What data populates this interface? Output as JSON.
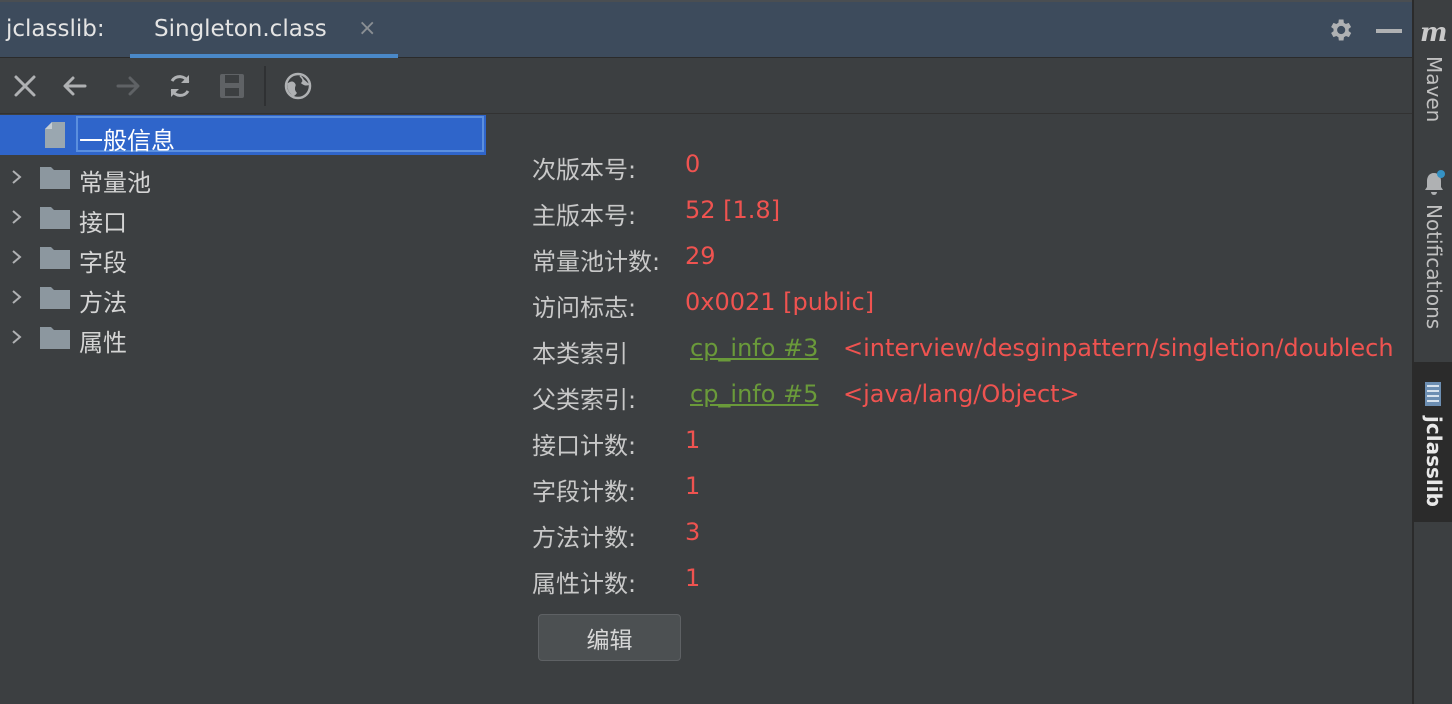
{
  "titlebar": {
    "tool_title": "jclasslib:",
    "tab_label": "Singleton.class",
    "tab_close": "×",
    "icons": [
      "gear-icon",
      "minimize-icon"
    ]
  },
  "toolbar": {
    "icons": [
      "close-icon",
      "back-arrow-icon",
      "forward-arrow-icon",
      "refresh-icon",
      "save-icon",
      "browser-icon"
    ]
  },
  "tree": {
    "items": [
      {
        "label": "一般信息",
        "type": "file",
        "selected": true
      },
      {
        "label": "常量池",
        "type": "folder"
      },
      {
        "label": "接口",
        "type": "folder"
      },
      {
        "label": "字段",
        "type": "folder"
      },
      {
        "label": "方法",
        "type": "folder"
      },
      {
        "label": "属性",
        "type": "folder"
      }
    ]
  },
  "info": {
    "minor_version": {
      "label": "次版本号:",
      "value": "0"
    },
    "major_version": {
      "label": "主版本号:",
      "value": "52 [1.8]"
    },
    "constant_pool_count": {
      "label": "常量池计数:",
      "value": "29"
    },
    "access_flags": {
      "label": "访问标志:",
      "value": "0x0021 [public]"
    },
    "this_class": {
      "label": "本类索引",
      "link": "cp_info #3",
      "value": "<interview/desginpattern/singletion/doublech"
    },
    "super_class": {
      "label": "父类索引:",
      "link": "cp_info #5",
      "value": "<java/lang/Object>"
    },
    "interfaces_count": {
      "label": "接口计数:",
      "value": "1"
    },
    "fields_count": {
      "label": "字段计数:",
      "value": "1"
    },
    "methods_count": {
      "label": "方法计数:",
      "value": "3"
    },
    "attributes_count": {
      "label": "属性计数:",
      "value": "1"
    },
    "edit_button": "编辑"
  },
  "right_strip": {
    "maven_logo": "m",
    "maven": "Maven",
    "notifications": "Notifications",
    "jclasslib": "jclasslib"
  },
  "colors": {
    "selection": "#2f65ca",
    "value_red": "#ef5350",
    "link_green": "#6a9a3a",
    "tab_underline": "#4a88c7"
  }
}
